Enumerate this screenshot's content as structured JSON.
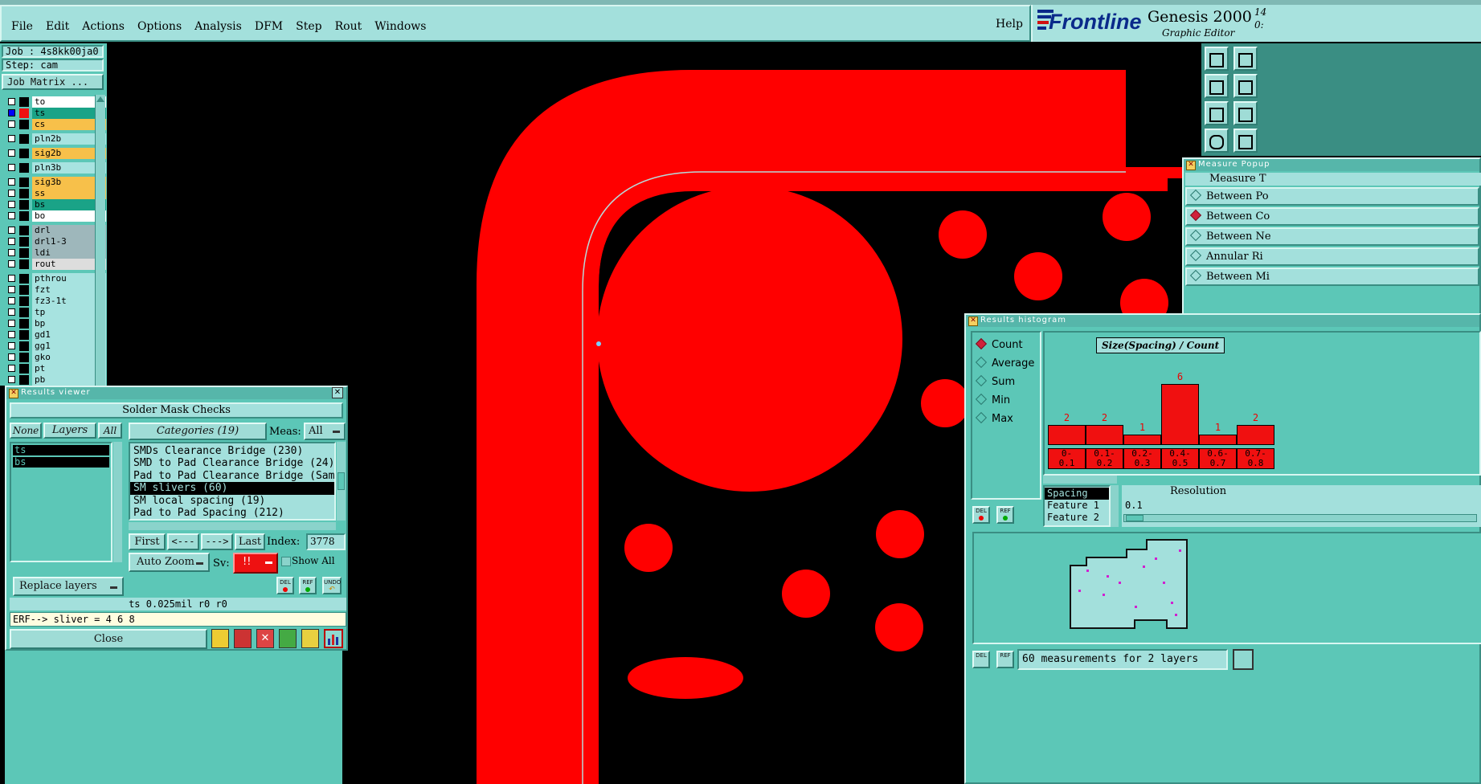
{
  "menu": {
    "items": [
      "File",
      "Edit",
      "Actions",
      "Options",
      "Analysis",
      "DFM",
      "Step",
      "Rout",
      "Windows"
    ],
    "help": "Help"
  },
  "brand": {
    "logo_text": "Frontline",
    "product": "Genesis 2000",
    "version_fragment": "14",
    "version_fragment2": "0:",
    "subtitle": "Graphic Editor"
  },
  "job": {
    "job_label": "Job : 4s8kk00ja0",
    "step_label": "Step: cam",
    "matrix_button": "Job Matrix ..."
  },
  "layers": [
    {
      "name": "to",
      "color": "#ffffff",
      "checked": false,
      "swatch": "#000000"
    },
    {
      "name": "ts",
      "color": "#1aa387",
      "checked": true,
      "swatch": "#ee1111"
    },
    {
      "name": "cs",
      "color": "#f7c04a",
      "checked": false,
      "swatch": "#000000"
    },
    {
      "name": "pln2b",
      "color": "#a7e3e0",
      "checked": false,
      "swatch": "#000000"
    },
    {
      "name": "sig2b",
      "color": "#f7c04a",
      "checked": false,
      "swatch": "#000000"
    },
    {
      "name": "pln3b",
      "color": "#a7e3e0",
      "checked": false,
      "swatch": "#000000"
    },
    {
      "name": "sig3b",
      "color": "#f7c04a",
      "checked": false,
      "swatch": "#000000"
    },
    {
      "name": "ss",
      "color": "#f7c04a",
      "checked": false,
      "swatch": "#000000"
    },
    {
      "name": "bs",
      "color": "#1aa387",
      "checked": false,
      "swatch": "#000000"
    },
    {
      "name": "bo",
      "color": "#ffffff",
      "checked": false,
      "swatch": "#000000"
    },
    {
      "name": "drl",
      "color": "#9eb7bb",
      "checked": false,
      "swatch": "#000000"
    },
    {
      "name": "drl1-3",
      "color": "#9eb7bb",
      "checked": false,
      "swatch": "#000000"
    },
    {
      "name": "ldi",
      "color": "#9eb7bb",
      "checked": false,
      "swatch": "#000000"
    },
    {
      "name": "rout",
      "color": "#dddddd",
      "checked": false,
      "swatch": "#000000"
    },
    {
      "name": "pthrou",
      "color": "#a7e3e0",
      "checked": false,
      "swatch": "#000000"
    },
    {
      "name": "fzt",
      "color": "#a7e3e0",
      "checked": false,
      "swatch": "#000000"
    },
    {
      "name": "fz3-1t",
      "color": "#a7e3e0",
      "checked": false,
      "swatch": "#000000"
    },
    {
      "name": "tp",
      "color": "#a7e3e0",
      "checked": false,
      "swatch": "#000000"
    },
    {
      "name": "bp",
      "color": "#a7e3e0",
      "checked": false,
      "swatch": "#000000"
    },
    {
      "name": "gd1",
      "color": "#a7e3e0",
      "checked": false,
      "swatch": "#000000"
    },
    {
      "name": "gg1",
      "color": "#a7e3e0",
      "checked": false,
      "swatch": "#000000"
    },
    {
      "name": "gko",
      "color": "#a7e3e0",
      "checked": false,
      "swatch": "#000000"
    },
    {
      "name": "pt",
      "color": "#a7e3e0",
      "checked": false,
      "swatch": "#000000"
    },
    {
      "name": "pb",
      "color": "#a7e3e0",
      "checked": false,
      "swatch": "#000000"
    }
  ],
  "results_viewer": {
    "title": "Results viewer",
    "header": "Solder Mask Checks",
    "none_btn": "None",
    "layers_btn": "Layers",
    "all_btn": "All",
    "categories_btn": "Categories (19)",
    "meas_label": "Meas:",
    "meas_value": "All",
    "layer_list": [
      "ts",
      "bs"
    ],
    "categories": [
      "SMDs Clearance Bridge (230)",
      "SMD to Pad Clearance Bridge (24)",
      "Pad to Pad Clearance Bridge (Same",
      "SM slivers (60)",
      "SM local spacing (19)",
      "Pad to Pad Spacing (212)"
    ],
    "selected_category": 3,
    "first_btn": "First",
    "prev_btn": "<---",
    "next_btn": "--->",
    "last_btn": "Last",
    "index_label": "Index:",
    "index_value": "3778",
    "auto_zoom": "Auto Zoom",
    "sv_label": "Sv:",
    "sv_value": "!!",
    "show_all": "Show All",
    "replace_layers": "Replace layers",
    "del_label": "DEL",
    "ref_label": "REF",
    "undo_label": "UNDO",
    "status_text": "ts 0.025mil  r0  r0",
    "erf_text": "ERF--> sliver = 4 6 8",
    "close_btn": "Close"
  },
  "measure_popup": {
    "title": "Measure Popup",
    "header": "Measure T",
    "options": [
      "Between Po",
      "Between Co",
      "Between Ne",
      "Annular Ri",
      "Between Mi"
    ],
    "selected": 1
  },
  "histogram": {
    "title": "Results histogram",
    "modes": [
      "Count",
      "Average",
      "Sum",
      "Min",
      "Max"
    ],
    "selected_mode": 0,
    "chart_title": "Size(Spacing) / Count",
    "bins": [
      {
        "label": "0-\n0.1",
        "count": 2
      },
      {
        "label": "0.1-\n0.2",
        "count": 2
      },
      {
        "label": "0.2-\n0.3",
        "count": 1
      },
      {
        "label": "0.4-\n0.5",
        "count": 6
      },
      {
        "label": "0.6-\n0.7",
        "count": 1
      },
      {
        "label": "0.7-\n0.8",
        "count": 2
      }
    ],
    "attr_list": [
      "Spacing",
      "Feature 1",
      "Feature 2"
    ],
    "resolution_label": "Resolution",
    "resolution_value": "0.1",
    "del_label": "DEL",
    "ref_label": "REF",
    "footer": "60 measurements for 2 layers"
  },
  "colors": {
    "canvas_bg": "#000000",
    "copper": "#ff0000",
    "panel": "#5cc7b7",
    "light_panel": "#a3e0dc"
  }
}
